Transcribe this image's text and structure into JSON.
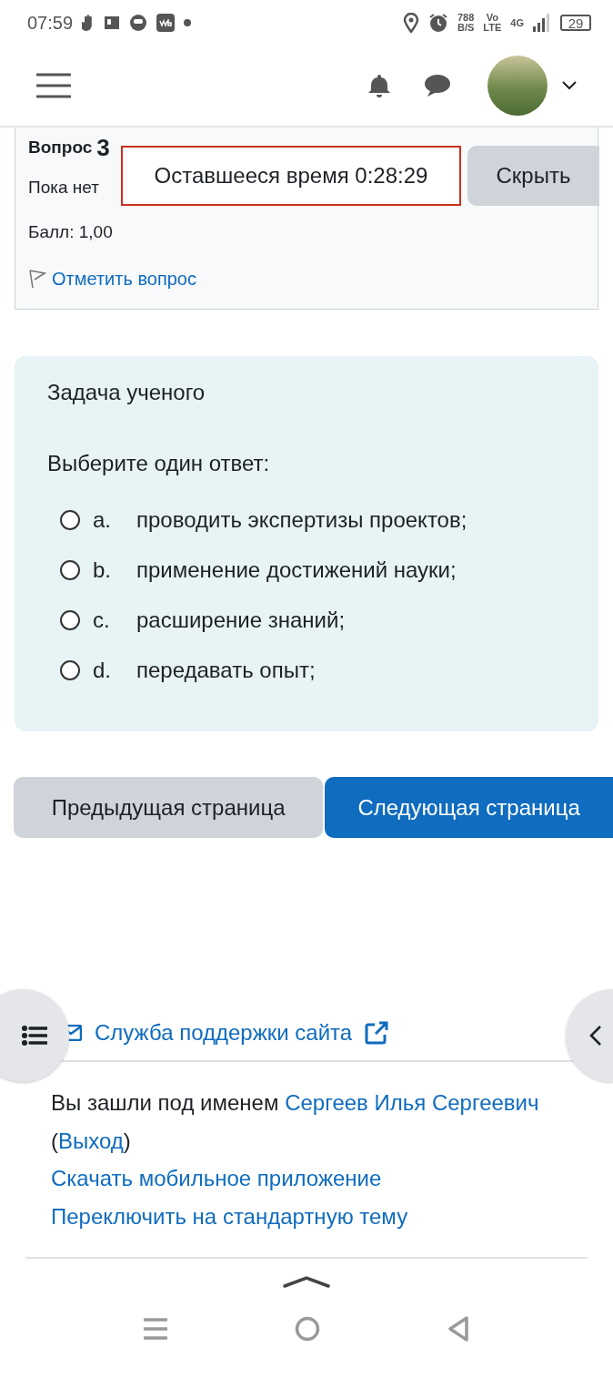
{
  "status_bar": {
    "time": "07:59",
    "net_speed": "788",
    "net_unit": "B/S",
    "volte_top": "Vo",
    "volte_bottom": "LTE",
    "network": "4G",
    "battery": "29"
  },
  "question_info": {
    "title": "Вопрос",
    "number": "3",
    "status": "Пока нет",
    "score": "Балл: 1,00",
    "flag_link": "Отметить вопрос"
  },
  "timer": {
    "text": "Оставшееся время 0:28:29",
    "hide_button": "Скрыть"
  },
  "question": {
    "text": "Задача ученого",
    "prompt": "Выберите один ответ:",
    "options": [
      {
        "letter": "a.",
        "text": "проводить экспертизы проектов;",
        "selected": false
      },
      {
        "letter": "b.",
        "text": "применение достижений науки;",
        "selected": false
      },
      {
        "letter": "c.",
        "text": "расширение знаний;",
        "selected": false
      },
      {
        "letter": "d.",
        "text": "передавать опыт;",
        "selected": false
      }
    ]
  },
  "navigation": [
    {
      "label": "Предыдущая страница",
      "kind": "secondary"
    },
    {
      "label": "Следующая страница",
      "kind": "primary"
    }
  ],
  "footer": {
    "support_link": "Служба поддержки сайта",
    "login_parts": [
      {
        "kind": "text",
        "text": "Вы зашли под именем "
      },
      {
        "kind": "link",
        "text": "Сергеев Илья Сергеевич"
      },
      {
        "kind": "text",
        "text": " ("
      },
      {
        "kind": "link",
        "text": "Выход"
      },
      {
        "kind": "text",
        "text": ")"
      }
    ],
    "links": [
      "Скачать мобильное приложение",
      "Переключить на стандартную тему"
    ]
  }
}
